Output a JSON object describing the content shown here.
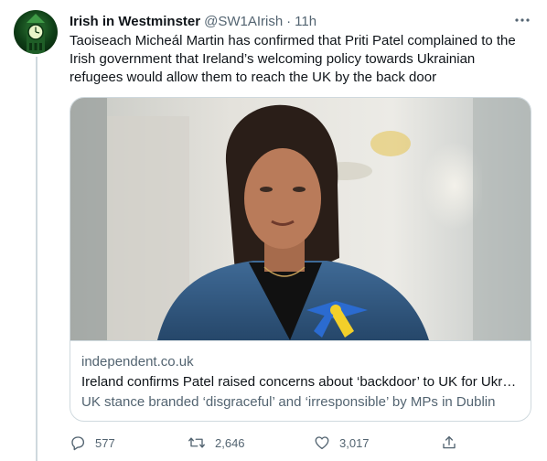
{
  "tweet": {
    "display_name": "Irish in Westminster",
    "handle": "@SW1AIrish",
    "separator": "·",
    "time": "11h",
    "text": "Taoiseach Micheál Martin has confirmed that Priti Patel complained to the Irish government that Ireland’s welcoming policy towards Ukrainian refugees would allow them to reach the UK by the back door"
  },
  "card": {
    "domain": "independent.co.uk",
    "title": "Ireland confirms Patel raised concerns about ‘backdoor’ to UK for Ukrai…",
    "description": "UK stance branded ‘disgraceful’ and ‘irresponsible’ by MPs in Dublin"
  },
  "actions": {
    "replies": "577",
    "retweets": "2,646",
    "likes": "3,017"
  },
  "icons": {
    "avatar": "clock-tower-icon",
    "more": "more-icon",
    "reply": "reply-icon",
    "retweet": "retweet-icon",
    "like": "heart-icon",
    "share": "share-icon"
  },
  "colors": {
    "text_primary": "#0f1419",
    "text_secondary": "#536471",
    "border": "#cfd9de",
    "avatar_green": "#2f7a36"
  }
}
